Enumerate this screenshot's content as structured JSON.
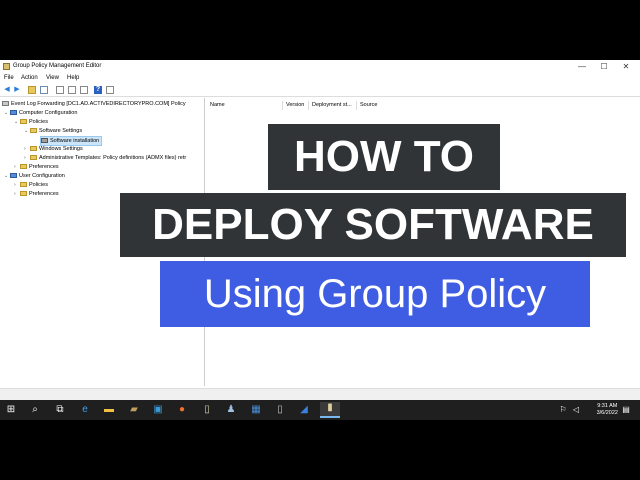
{
  "window": {
    "title": "Group Policy Management Editor",
    "controls": {
      "minimize": "—",
      "maximize": "☐",
      "close": "✕"
    }
  },
  "menu": [
    "File",
    "Action",
    "View",
    "Help"
  ],
  "toolbar": {
    "back": "◀",
    "forward": "▶",
    "help": "?"
  },
  "tree": [
    {
      "label": "Event Log Forwarding [DC1.AD.ACTIVEDIRECTORYPRO.COM] Policy",
      "level": 0,
      "chev": ""
    },
    {
      "label": "Computer Configuration",
      "level": 0,
      "chev": "⌄"
    },
    {
      "label": "Policies",
      "level": 1,
      "chev": "⌄"
    },
    {
      "label": "Software Settings",
      "level": 2,
      "chev": "⌄"
    },
    {
      "label": "Software installation",
      "level": 3,
      "chev": "",
      "selected": true
    },
    {
      "label": "Windows Settings",
      "level": 2,
      "chev": "›"
    },
    {
      "label": "Administrative Templates: Policy definitions (ADMX files) retr",
      "level": 2,
      "chev": "›"
    },
    {
      "label": "Preferences",
      "level": 1,
      "chev": "›"
    },
    {
      "label": "User Configuration",
      "level": 0,
      "chev": "⌄"
    },
    {
      "label": "Policies",
      "level": 1,
      "chev": "›"
    },
    {
      "label": "Preferences",
      "level": 1,
      "chev": "›"
    }
  ],
  "columns": [
    "Name",
    "Version",
    "Deployment st...",
    "Source"
  ],
  "banner": {
    "line1": "HOW TO",
    "line2": "DEPLOY SOFTWARE",
    "line3": "Using Group Policy"
  },
  "taskbar": {
    "time": "9:31 AM",
    "date": "3/6/2022"
  },
  "colors": {
    "banner_dark": "#303437",
    "banner_blue": "#3f5de3",
    "taskbar": "#1f1f1f"
  }
}
